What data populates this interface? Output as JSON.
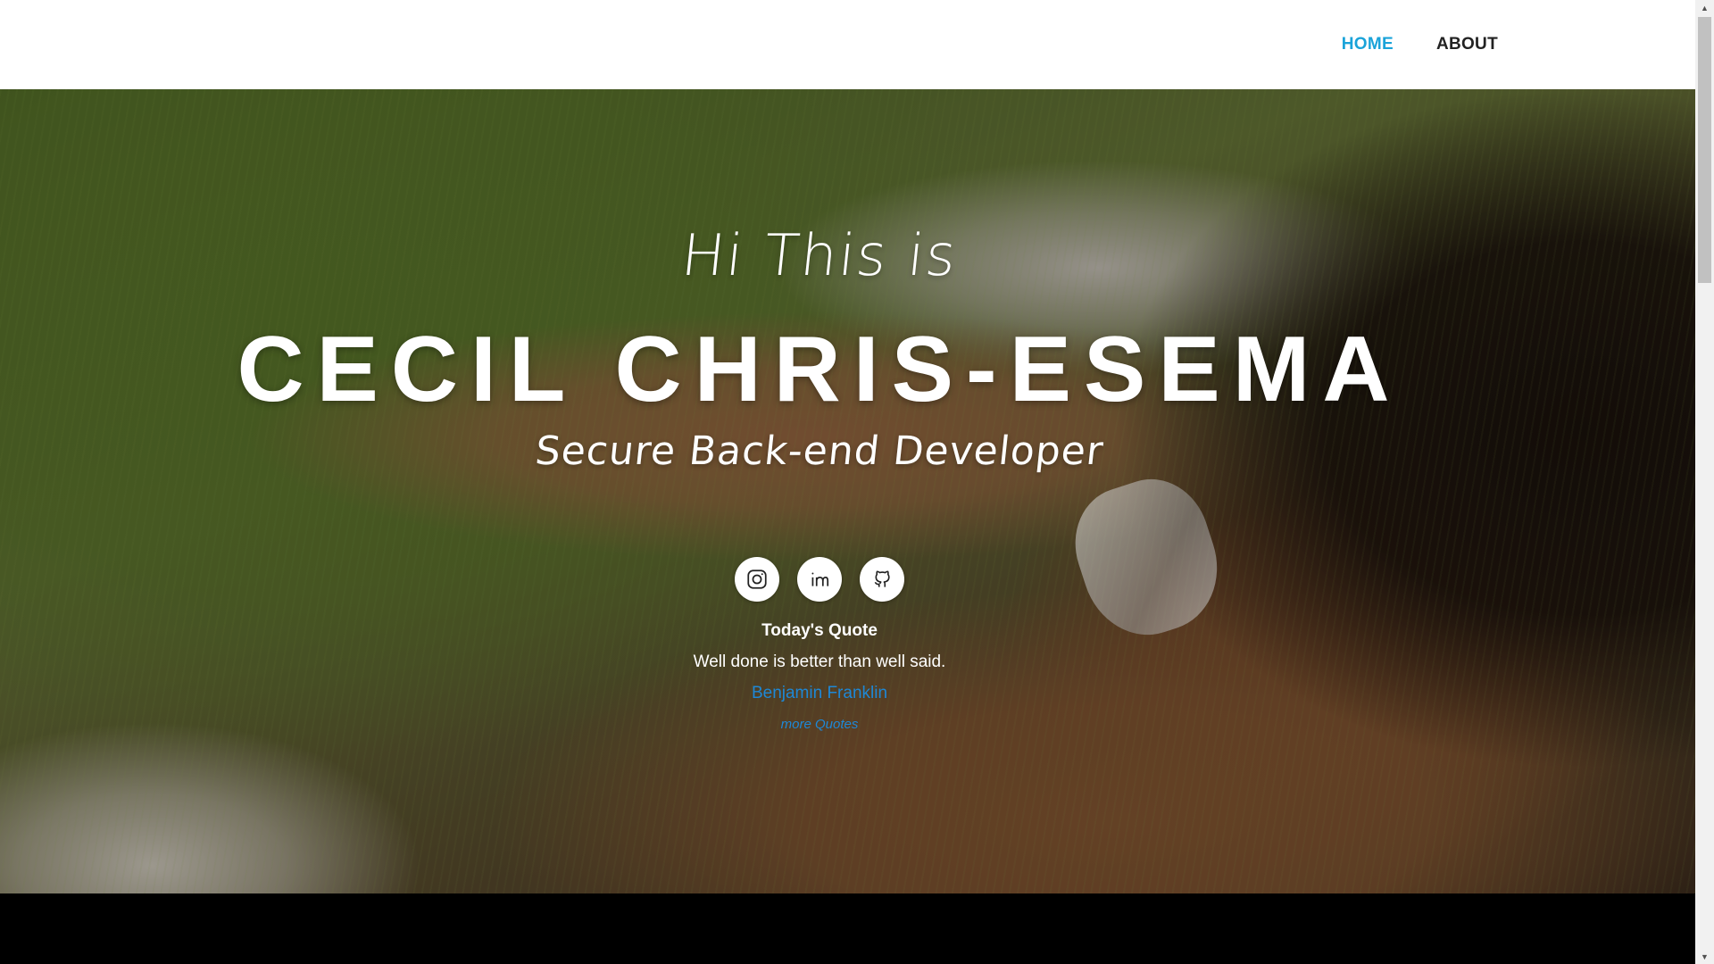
{
  "nav": {
    "home_label": "HOME",
    "about_label": "ABOUT",
    "active_color": "#1aa3d9"
  },
  "hero": {
    "greeting": "Hi This is",
    "name": "CECIL CHRIS-ESEMA",
    "role": "Secure Back-end Developer",
    "socials": [
      {
        "icon": "instagram-icon"
      },
      {
        "icon": "linkedin-icon"
      },
      {
        "icon": "github-icon"
      }
    ]
  },
  "quote": {
    "title": "Today's Quote",
    "text": "Well done is better than well said.",
    "author": "Benjamin Franklin",
    "more_link": "more Quotes",
    "link_color": "#1e88d6"
  }
}
